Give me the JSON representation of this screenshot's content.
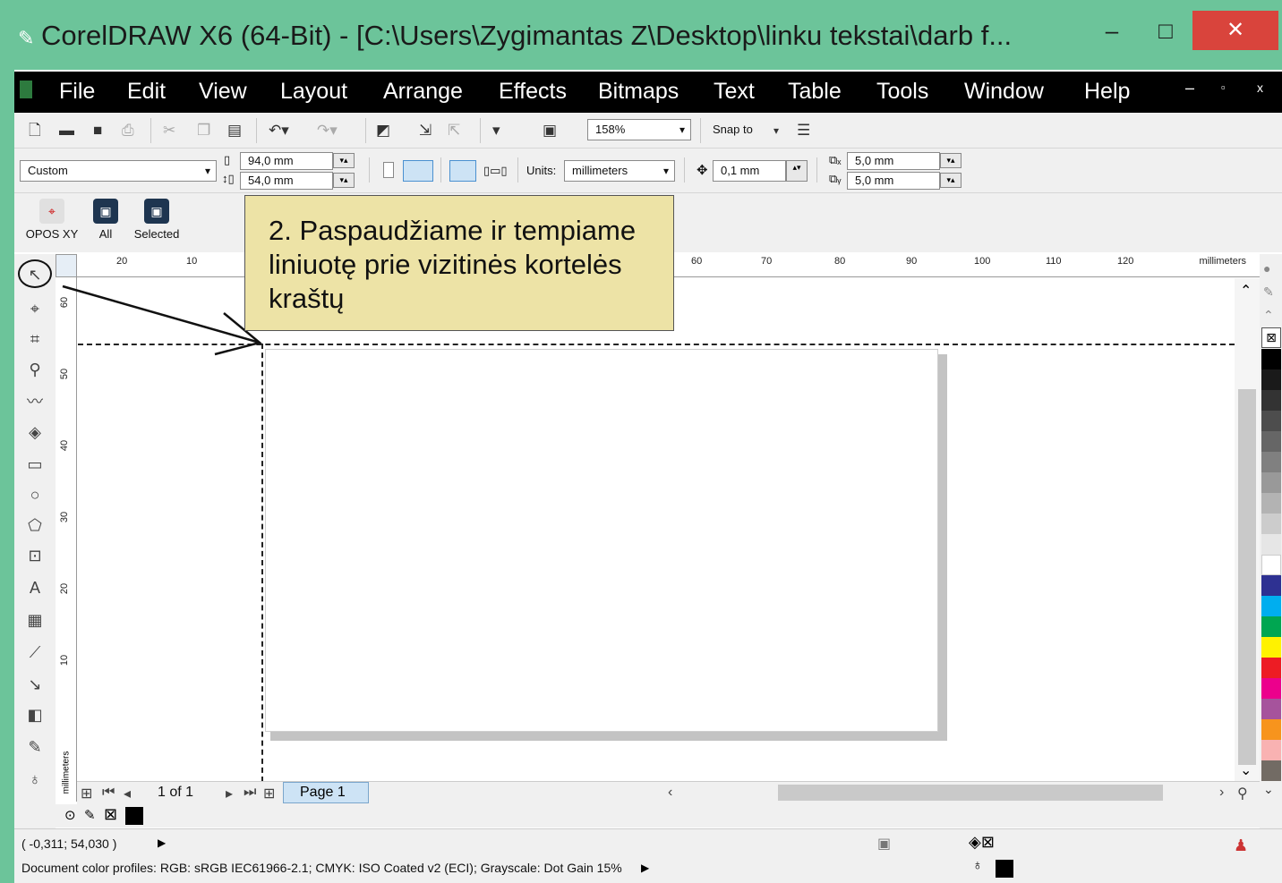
{
  "window": {
    "title": "CorelDRAW X6 (64-Bit) - [C:\\Users\\Zygimantas Z\\Desktop\\linku tekstai\\darb f...",
    "minimize": "–",
    "maximize": "□",
    "close": "✕",
    "accent_color": "#6cc49a"
  },
  "menu": {
    "items": [
      "File",
      "Edit",
      "View",
      "Layout",
      "Arrange",
      "Effects",
      "Bitmaps",
      "Text",
      "Table",
      "Tools",
      "Window",
      "Help"
    ],
    "mdi_min": "–",
    "mdi_restore": "▫",
    "mdi_close": "x"
  },
  "standard_toolbar": {
    "zoom": "158%",
    "snap_to": "Snap to"
  },
  "property_bar": {
    "page_preset": "Custom",
    "width": "94,0 mm",
    "height": "54,0 mm",
    "units_label": "Units:",
    "units_value": "millimeters",
    "nudge": "0,1 mm",
    "dup_x": "5,0 mm",
    "dup_y": "5,0 mm"
  },
  "macros": [
    {
      "label": "OPOS XY",
      "icon": "opos-xy-icon"
    },
    {
      "label": "All",
      "icon": "all-macro-icon"
    },
    {
      "label": "Selected",
      "icon": "selected-macro-icon"
    }
  ],
  "ruler": {
    "h_ticks": [
      "20",
      "10",
      "60",
      "70",
      "80",
      "90",
      "100",
      "110",
      "120"
    ],
    "unit": "millimeters",
    "v_ticks": [
      "60",
      "50",
      "40",
      "30",
      "20",
      "10"
    ]
  },
  "callout": {
    "line1": "2. Paspaudžiame ir tempiame",
    "line2": "liniuotę prie vizitinės kortelės",
    "line3": "kraštų"
  },
  "page_nav": {
    "count": "1 of 1",
    "tab": "Page 1"
  },
  "palette": [
    "#000000",
    "#1a1a1a",
    "#333333",
    "#4d4d4d",
    "#666666",
    "#808080",
    "#999999",
    "#b3b3b3",
    "#cccccc",
    "#e6e6e6",
    "#ffffff",
    "#2e3192",
    "#00aeef",
    "#00a651",
    "#fff200",
    "#ed1c24",
    "#ec008c",
    "#a6539c",
    "#f7941d",
    "#f9b2b2",
    "#726b64"
  ],
  "status": {
    "coords": "( -0,311; 54,030 )",
    "profiles": "Document color profiles: RGB: sRGB IEC61966-2.1; CMYK: ISO Coated v2 (ECI); Grayscale: Dot Gain 15%"
  }
}
